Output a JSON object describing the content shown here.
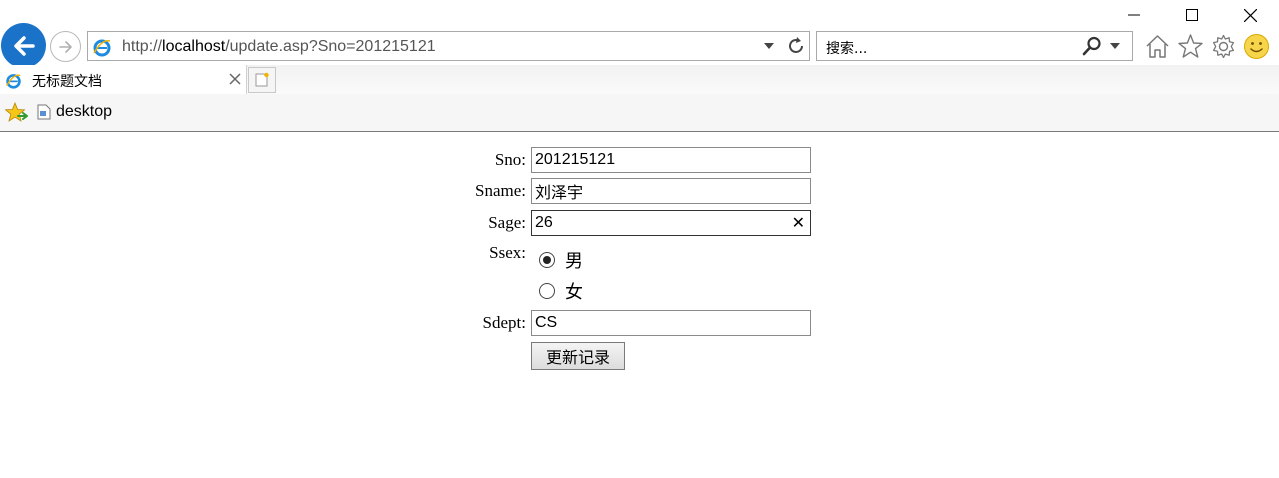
{
  "browser": {
    "address_url_prefix": "http://",
    "address_url_host": "localhost",
    "address_url_path": "/update.asp?Sno=201215121",
    "search_placeholder": "搜索...",
    "tab_title": "无标题文档",
    "favorites": [
      {
        "label": "desktop"
      }
    ],
    "accent_color": "#1a73c9"
  },
  "form": {
    "sno_label": "Sno:",
    "sno_value": "201215121",
    "sname_label": "Sname:",
    "sname_value": "刘泽宇",
    "sage_label": "Sage:",
    "sage_value": "26",
    "sage_clear_glyph": "✕",
    "ssex_label": "Ssex:",
    "ssex_options": [
      {
        "label": "男",
        "checked": true
      },
      {
        "label": "女",
        "checked": false
      }
    ],
    "sdept_label": "Sdept:",
    "sdept_value": "CS",
    "submit_label": "更新记录"
  }
}
